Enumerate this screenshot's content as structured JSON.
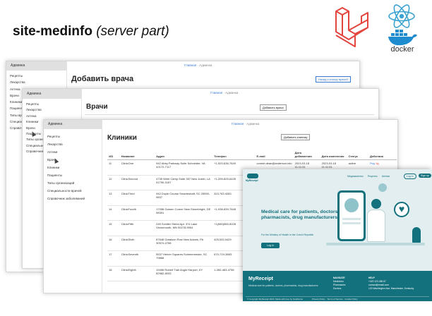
{
  "slide": {
    "title": "site-medinfo",
    "subtitle": "(server part)"
  },
  "logos": {
    "docker_label": "docker"
  },
  "sidebar": {
    "header": "Админка",
    "items": [
      "Рецепты",
      "Лекарства",
      "Аптеки",
      "Врачи",
      "Клиники",
      "Пациенты",
      "Типы организаций",
      "Специальности врачей",
      "Справочник заболеваний"
    ],
    "items_w1": [
      "Рецепты",
      "Лекарства",
      "Аптека",
      "Врачи",
      "Клиники",
      "Пациенты",
      "Типы врачей",
      "Специальн",
      "Справочник"
    ],
    "items_w2": [
      "Рецепты",
      "Лекарства",
      "Аптека",
      "Клиники",
      "Врачи",
      "Пациенты",
      "Типы организ",
      "Специальности",
      "Справочник"
    ]
  },
  "win1": {
    "crumb_main": "Главная",
    "crumb_current": "Админка",
    "title": "Добавить врача",
    "back_button": "Назад к списку врачей"
  },
  "win2": {
    "crumb_main": "Главная",
    "crumb_current": "Админка",
    "title": "Врачи",
    "add_button": "Добавить врача"
  },
  "win3": {
    "crumb_main": "Главная",
    "crumb_current": "Админка",
    "title": "Клиники",
    "add_button": "Добавить клинику",
    "columns": [
      "#ID",
      "Название",
      "Адрес",
      "Телефон",
      "E-mail",
      "Дата добавления",
      "Дата изменения",
      "Статус",
      "Действия"
    ],
    "action_view": "Ред",
    "action_delete": "Уд",
    "rows": [
      {
        "id": "11",
        "name": "ClinicOne",
        "address": "942 Abby Parkway Suite Schneider, VA 42172-7117",
        "phone": "+1-520-636-7649",
        "email": "connie.dean@anderson.info",
        "created": "2023-03-18 11:11:31",
        "updated": "2023-03-18 11:11:31",
        "status": "active"
      },
      {
        "id": "12",
        "name": "ClinicSecond",
        "address": "4735 Wirle Camp Suite 357 New Justin, LA 51790-3157",
        "phone": "+1-339-825-6435",
        "email": "",
        "created": "",
        "updated": "",
        "status": ""
      },
      {
        "id": "13",
        "name": "ClinicThird",
        "address": "942 Doyle Course Smarteshaft, SC 25990-9837",
        "phone": "323.763.4283",
        "email": "",
        "created": "",
        "updated": "",
        "status": ""
      },
      {
        "id": "14",
        "name": "ClinicFourth",
        "address": "17058 Garsen Corner New Stonebright, DE 98391",
        "phone": "+1-938-839-7648",
        "email": "",
        "created": "",
        "updated": "",
        "status": ""
      },
      {
        "id": "15",
        "name": "ClinicFifth",
        "address": "245 Schiller Street Apt. 374 Lake Victormouth, MN 90278-9554",
        "phone": "+1(980)565-5028",
        "email": "",
        "created": "",
        "updated": "",
        "status": ""
      },
      {
        "id": "16",
        "name": "ClinicSixth",
        "address": "87648 Garaison Row New Adonis, PA 30974-0758",
        "phone": "425.533.0429",
        "email": "",
        "created": "",
        "updated": "",
        "status": ""
      },
      {
        "id": "17",
        "name": "ClinicSeventh",
        "address": "5537 Heiner Squares Scheeemester, SC 79868",
        "phone": "670-719-3883",
        "email": "",
        "created": "",
        "updated": "",
        "status": ""
      },
      {
        "id": "18",
        "name": "ClinicEighth",
        "address": "19496 Robert Trail Angie Harport, KY 82982-8033",
        "phone": "1-260-463-4756",
        "email": "",
        "created": "",
        "updated": "",
        "status": ""
      }
    ]
  },
  "landing": {
    "logo": "MyReceipt",
    "nav": [
      "Медикаменты",
      "Рецепты",
      "Аптеки"
    ],
    "login": "Log in",
    "signup": "Sign up",
    "hero_title": "Medical care for patients, doctors, pharmacists, drug manufacturers",
    "hero_sub": "For the Ministry of Health in the Czech Republic",
    "hero_button": "Log in",
    "footer_brand": "MyReceipt",
    "footer_tagline": "Medical care for patients, doctors, pharmacists, drug manufacturers",
    "footer_col1_title": "NAVIGATE",
    "footer_col1": [
      "Medicines",
      "Pharmacies",
      "Doctors"
    ],
    "footer_col2_title": "HELP",
    "footer_col2": [
      "+420 123 456 67",
      "contact@email.com",
      "123 Washington Ave, Manchester, Kentucky"
    ],
    "copyright": "© Copyright MyReceipt 2023. Made with love by NotaSome",
    "legal": "Privacy Policy · Terms of Service · Cookie Policy"
  },
  "colors": {
    "laravel": "#e4453e",
    "react": "#3aa2d0",
    "docker": "#1f8ccf",
    "teal": "#13707d"
  }
}
